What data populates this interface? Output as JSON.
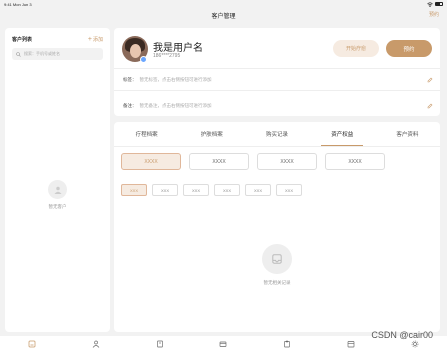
{
  "status_bar": {
    "time": "9:41",
    "date": "Mon Jun 3"
  },
  "nav": {
    "title": "客户管理",
    "action": "预约"
  },
  "customer_list": {
    "title": "客户列表",
    "add_label": "添加",
    "search_placeholder": "搜索：手机号或姓名",
    "empty_text": "暂无客户"
  },
  "profile": {
    "name": "我是用户名",
    "phone": "186****2795",
    "start_button": "开始疗愈",
    "book_button": "预约",
    "rows": [
      {
        "label": "标签：",
        "value": "暂无标签，点击右侧按钮可进行添加"
      },
      {
        "label": "备注：",
        "value": "暂无备注，点击右侧按钮可进行添加"
      }
    ]
  },
  "tabs": [
    "疗程档案",
    "护肤档案",
    "购买记录",
    "资产权益",
    "客户资料"
  ],
  "active_tab": 3,
  "benefits": [
    "XXXX",
    "XXXX",
    "XXXX",
    "XXXX"
  ],
  "chips": [
    "XXX",
    "XXX",
    "XXX",
    "XXX",
    "XXX",
    "XXX"
  ],
  "empty_records": "暂无相关记录",
  "watermark": "CSDN @cair00",
  "colors": {
    "accent": "#c89a6a",
    "accent_light": "#f6ebe1",
    "background": "#f2f2f2"
  },
  "tab_bar_icons": [
    "customer-icon",
    "user-icon",
    "document-icon",
    "wallet-icon",
    "clipboard-icon",
    "calendar-icon",
    "settings-icon"
  ]
}
